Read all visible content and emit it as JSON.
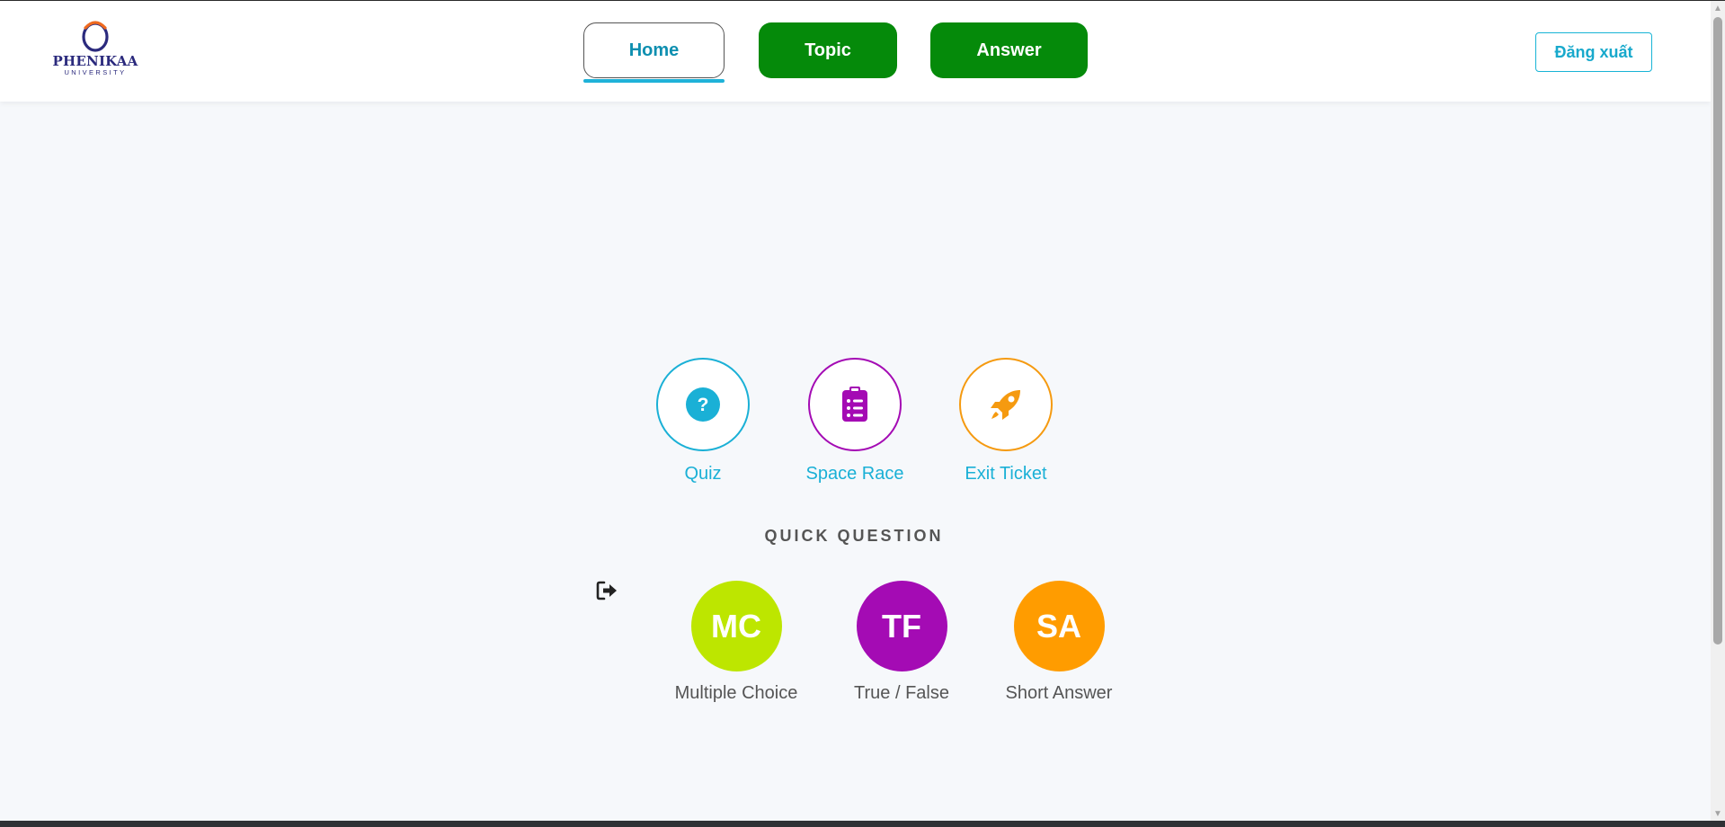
{
  "header": {
    "logo": {
      "name": "PHENIKAA",
      "sub": "UNIVERSITY"
    },
    "nav": [
      {
        "label": "Home",
        "active": true
      },
      {
        "label": "Topic",
        "active": false
      },
      {
        "label": "Answer",
        "active": false
      }
    ],
    "logout_label": "Đăng xuất"
  },
  "activities": [
    {
      "label": "Quiz",
      "icon": "question-circle-icon",
      "color": "#1ab0d6"
    },
    {
      "label": "Space Race",
      "icon": "clipboard-list-icon",
      "color": "#a40bb4"
    },
    {
      "label": "Exit Ticket",
      "icon": "rocket-icon",
      "color": "#f59a10"
    }
  ],
  "quick_question": {
    "heading": "QUICK QUESTION",
    "items": [
      {
        "abbr": "MC",
        "label": "Multiple Choice",
        "color": "#bde600"
      },
      {
        "abbr": "TF",
        "label": "True / False",
        "color": "#a40bb4"
      },
      {
        "abbr": "SA",
        "label": "Short Answer",
        "color": "#ff9c00"
      }
    ]
  },
  "colors": {
    "nav_active_green": "#058a0a",
    "accent_cyan": "#1ab0d6"
  }
}
